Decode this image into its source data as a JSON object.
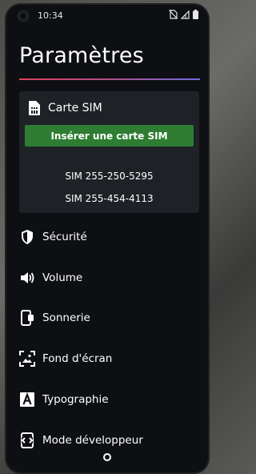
{
  "status_bar": {
    "time": "10:34"
  },
  "page": {
    "title": "Paramètres"
  },
  "sim": {
    "label": "Carte SIM",
    "insert_button": "Insérer une carte SIM",
    "numbers": [
      "SIM 255-250-5295",
      "SIM 255-454-4113"
    ]
  },
  "menu": [
    {
      "label": "Sécurité",
      "icon": "shield-icon"
    },
    {
      "label": "Volume",
      "icon": "volume-icon"
    },
    {
      "label": "Sonnerie",
      "icon": "ringtone-icon"
    },
    {
      "label": "Fond d'écran",
      "icon": "wallpaper-icon"
    },
    {
      "label": "Typographie",
      "icon": "typography-icon"
    },
    {
      "label": "Mode développeur",
      "icon": "developer-icon"
    }
  ],
  "colors": {
    "accent_green": "#2e7d32",
    "background": "#0d0f12",
    "card": "#1e2226"
  }
}
